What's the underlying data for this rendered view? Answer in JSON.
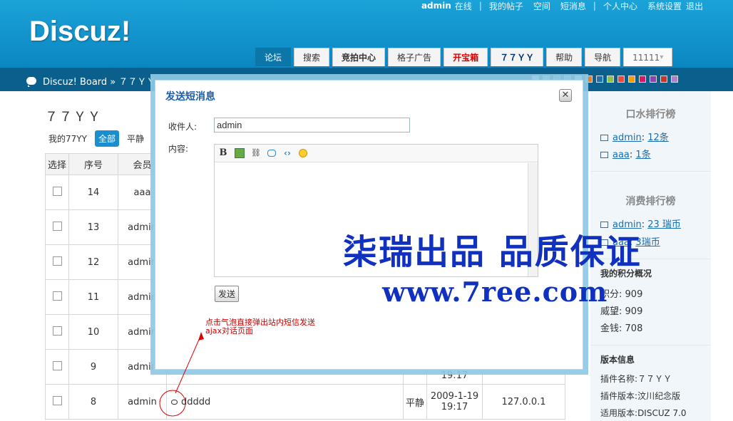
{
  "header": {
    "logo": "Discuz!",
    "top_links": {
      "user": "admin",
      "online": "在线",
      "my_posts": "我的帖子",
      "space": "空间",
      "messages": "短消息",
      "profile": "个人中心",
      "settings": "系统设置",
      "logout": "退出"
    },
    "nav_tabs": [
      {
        "label": "论坛",
        "style": "active"
      },
      {
        "label": "搜索",
        "style": "normal"
      },
      {
        "label": "竞拍中心",
        "style": "bold"
      },
      {
        "label": "格子广告",
        "style": "normal"
      },
      {
        "label": "开宝箱",
        "style": "red"
      },
      {
        "label": "７７ＹＹ",
        "style": "blue"
      },
      {
        "label": "帮助",
        "style": "normal"
      },
      {
        "label": "导航",
        "style": "normal"
      },
      {
        "label": "11111",
        "style": "drop"
      }
    ]
  },
  "breadcrumb": "Discuz! Board » ７７ＹＹ",
  "swatch_colors": [
    "#ffffff",
    "#cccccc",
    "#999999",
    "#7ecbd3",
    "#ffffff",
    "#e67e22",
    "#1f6fb2",
    "#8bc34a",
    "#e74c3c",
    "#f39c12",
    "#d81b60",
    "#8e44ad",
    "#c0392b",
    "#b07fd0"
  ],
  "page": {
    "title": "７７ＹＹ",
    "subtabs": [
      "我的77YY",
      "全部",
      "平静"
    ],
    "table": {
      "headers": [
        "选择",
        "序号",
        "会员"
      ],
      "rows": [
        {
          "no": "14",
          "member": "aaa"
        },
        {
          "no": "13",
          "member": "admin"
        },
        {
          "no": "12",
          "member": "admin"
        },
        {
          "no": "11",
          "member": "admin"
        },
        {
          "no": "10",
          "member": "admin"
        },
        {
          "no": "9",
          "member": "admin",
          "time_tail": "19:17"
        }
      ],
      "last_row": {
        "no": "8",
        "member": "admin",
        "content": "ddddd",
        "mood": "平静",
        "date": "2009-1-19",
        "time": "19:17",
        "ip": "127.0.0.1"
      }
    }
  },
  "sidebar": {
    "chatter_title": "口水排行榜",
    "chatter": [
      {
        "user": "admin",
        "value": "12条"
      },
      {
        "user": "aaa",
        "value": "1条"
      }
    ],
    "spend_title": "消费排行榜",
    "spend": [
      {
        "user": "admin",
        "value": "23 瑞币"
      },
      {
        "user": "aaa",
        "value": "3瑞币"
      }
    ],
    "points_title": "我的积分概况",
    "points": [
      {
        "label": "积分",
        "value": "909"
      },
      {
        "label": "威望",
        "value": "909"
      },
      {
        "label": "金钱",
        "value": "708"
      }
    ],
    "version_title": "版本信息",
    "version": [
      {
        "label": "插件名称",
        "value": "７７ＹＹ"
      },
      {
        "label": "插件版本",
        "value": "汶川纪念版"
      },
      {
        "label": "适用版本",
        "value": "DISCUZ 7.0"
      }
    ]
  },
  "dialog": {
    "title": "发送短消息",
    "close": "✕",
    "to_label": "收件人:",
    "to_value": "admin",
    "content_label": "内容:",
    "toolbar": [
      "B",
      "img",
      "link",
      "quote",
      "code",
      "smile"
    ],
    "send_button": "发送"
  },
  "watermark": {
    "line1": "柒瑞出品 品质保证",
    "line2": "www.7ree.com"
  },
  "annotation": {
    "line1": "点击气泡直接弹出站内短信发送",
    "line2": "ajax对话页面"
  }
}
